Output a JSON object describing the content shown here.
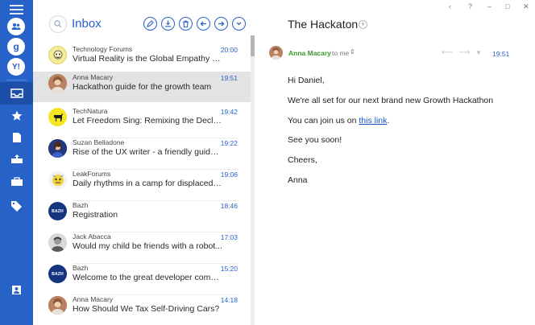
{
  "list": {
    "title": "Inbox",
    "messages": [
      {
        "from": "Technology Forums",
        "subject": "Virtual Reality is the Global Empathy Ma...",
        "time": "20:00"
      },
      {
        "from": "Anna Macary",
        "subject": "Hackathon guide for the growth team",
        "time": "19:51"
      },
      {
        "from": "TechNatura",
        "subject": "Let Freedom Sing: Remixing the Declaratio...",
        "time": "19:42"
      },
      {
        "from": "Suzan Belladone",
        "subject": "Rise of the UX writer - a friendly guide of...",
        "time": "19:22"
      },
      {
        "from": "LeakForums",
        "subject": "Daily rhythms in a camp for displaced pe...",
        "time": "19:06"
      },
      {
        "from": "Bazh",
        "subject": "Registration",
        "time": "18:46",
        "avatar_text": "BAZH"
      },
      {
        "from": "Jack Abacca",
        "subject": "Would my child be friends with a robot...",
        "time": "17:03"
      },
      {
        "from": "Bazh",
        "subject": "Welcome to the great developer commu...",
        "time": "15:20",
        "avatar_text": "BAZH"
      },
      {
        "from": "Anna Macary",
        "subject": "How Should We Tax Self-Driving Cars?",
        "time": "14:18"
      }
    ]
  },
  "rail": {
    "accounts": [
      "g",
      "Y!"
    ]
  },
  "reader": {
    "title": "The Hackaton",
    "sender": "Anna Macary",
    "to": "to me",
    "time": "19:51",
    "body": {
      "greeting": "Hi Daniel,",
      "line1": "We're all set for our next brand new Growth Hackathon",
      "line2_pre": "You can join us on ",
      "line2_link": "this link",
      "line2_post": ".",
      "line3": "See you soon!",
      "line4": "Cheers,",
      "signature": "Anna"
    }
  },
  "window": {
    "controls": [
      "‹",
      "?",
      "–",
      "□",
      "✕"
    ]
  },
  "colors": {
    "accent": "#2762c9",
    "sender_green": "#3a9a2c",
    "selected_row": "#e3e3e3"
  }
}
